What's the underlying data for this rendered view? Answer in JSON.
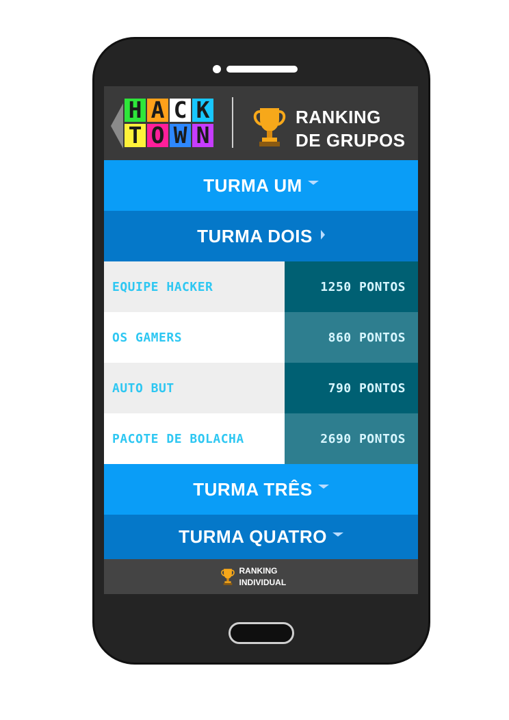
{
  "app": {
    "logo_text": "HACK TOWN",
    "logo_letters_top": [
      "H",
      "A",
      "C",
      "K"
    ],
    "logo_letters_bottom": [
      "T",
      "O",
      "W",
      "N"
    ],
    "logo_colors_top": [
      "#2ee63a",
      "#ffa11a",
      "#ffffff",
      "#18c7ff"
    ],
    "logo_colors_bottom": [
      "#fff23a",
      "#ff1f9a",
      "#2e88ff",
      "#c63cff"
    ],
    "title_line1": "RANKING",
    "title_line2": "DE GRUPOS"
  },
  "colors": {
    "turma_bright": "#0a9df7",
    "turma_dark": "#0578c9",
    "row_light": "#eeeeee",
    "row_white": "#ffffff",
    "pts_dark": "#006073",
    "pts_mid": "#2e7e8f",
    "name_text": "#2ec7f2",
    "trophy": "#f7a81a"
  },
  "turmas": [
    {
      "label": "TURMA UM",
      "state": "collapsed"
    },
    {
      "label": "TURMA DOIS",
      "state": "expanded"
    },
    {
      "label": "TURMA TRÊS",
      "state": "collapsed"
    },
    {
      "label": "TURMA QUATRO",
      "state": "collapsed"
    }
  ],
  "ranking_rows": [
    {
      "name": "EQUIPE HACKER",
      "points": "1250 PONTOS"
    },
    {
      "name": "OS GAMERS",
      "points": "860 PONTOS"
    },
    {
      "name": "AUTO BUT",
      "points": "790 PONTOS"
    },
    {
      "name": "PACOTE DE BOLACHA",
      "points": "2690 PONTOS"
    }
  ],
  "bottom": {
    "line1": "RANKING",
    "line2": "INDIVIDUAL"
  }
}
